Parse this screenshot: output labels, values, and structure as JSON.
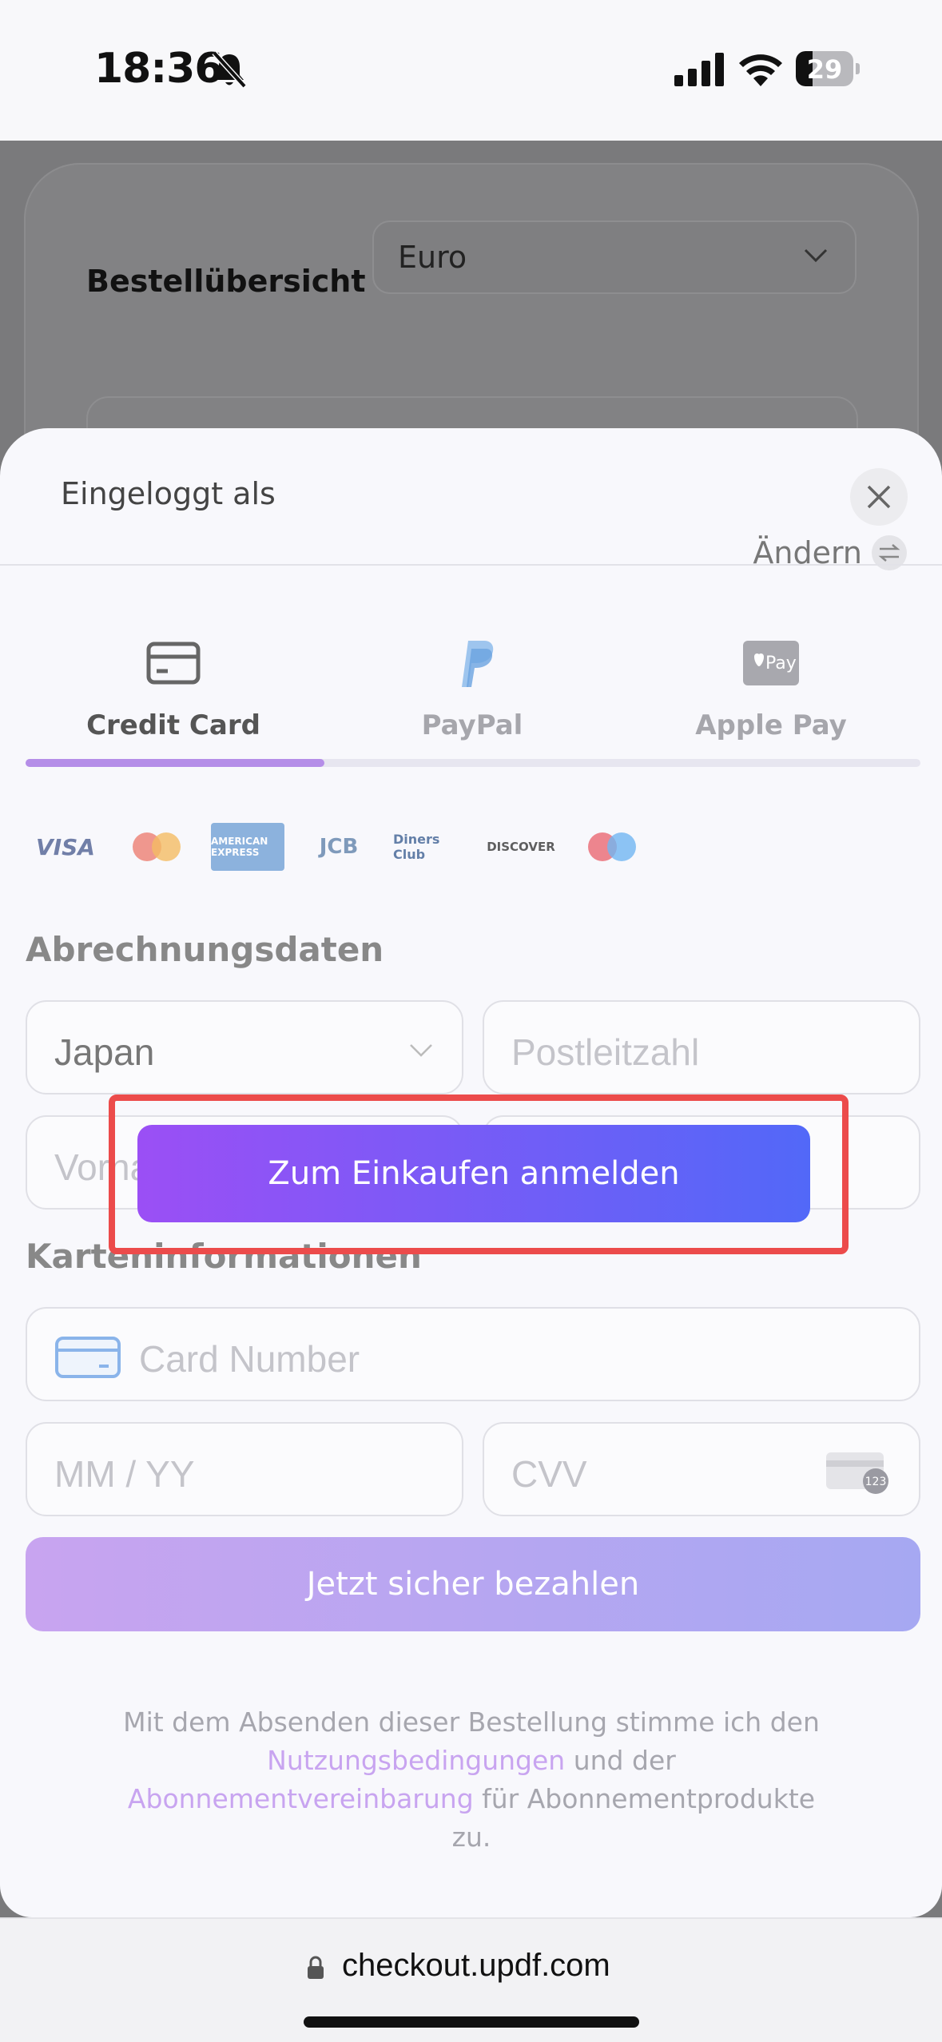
{
  "status_bar": {
    "time": "18:36",
    "battery_level": "29",
    "battery_fraction": 0.29,
    "icons": [
      "bell-slash-icon",
      "cellular-signal-icon",
      "wifi-icon",
      "battery-icon"
    ]
  },
  "background_page": {
    "title": "Bestellübersicht",
    "currency_selected": "Euro"
  },
  "sheet": {
    "logged_in_label": "Eingeloggt als",
    "change_label": "Ändern",
    "tabs": [
      {
        "label": "Credit Card",
        "icon": "credit-card-icon",
        "active": true
      },
      {
        "label": "PayPal",
        "icon": "paypal-icon",
        "active": false
      },
      {
        "label": "Apple Pay",
        "icon": "apple-pay-icon",
        "active": false
      }
    ],
    "apple_pay_badge": "Pay",
    "card_logos": {
      "visa": "VISA",
      "amex": "AMERICAN EXPRESS",
      "jcb": "JCB",
      "diners": "Diners Club",
      "discover": "DISCOVER",
      "maestro": "maestro"
    },
    "billing": {
      "title": "Abrechnungsdaten",
      "country_value": "Japan",
      "postal_placeholder": "Postleitzahl",
      "first_name_placeholder": "Vorname"
    },
    "card_info": {
      "title": "Karteninformationen",
      "card_number_placeholder": "Card Number",
      "expiry_placeholder": "MM / YY",
      "cvv_placeholder": "CVV",
      "cvv_badge": "123"
    },
    "pay_button": "Jetzt sicher bezahlen",
    "legal": {
      "part1": "Mit dem Absenden dieser Bestellung stimme ich den ",
      "terms_link": "Nutzungsbedingungen",
      "part2": " und der ",
      "subscription_link": "Abonnementvereinbarung",
      "part3": " für Abonnementprodukte zu."
    }
  },
  "overlay": {
    "login_button": "Zum Einkaufen anmelden"
  },
  "url_bar": {
    "url": "checkout.updf.com"
  },
  "colors": {
    "accent_purple": "#9b4ff5",
    "accent_blue": "#5268f8",
    "highlight_red": "#ec4b4b",
    "tab_indicator": "#b58ee8"
  }
}
